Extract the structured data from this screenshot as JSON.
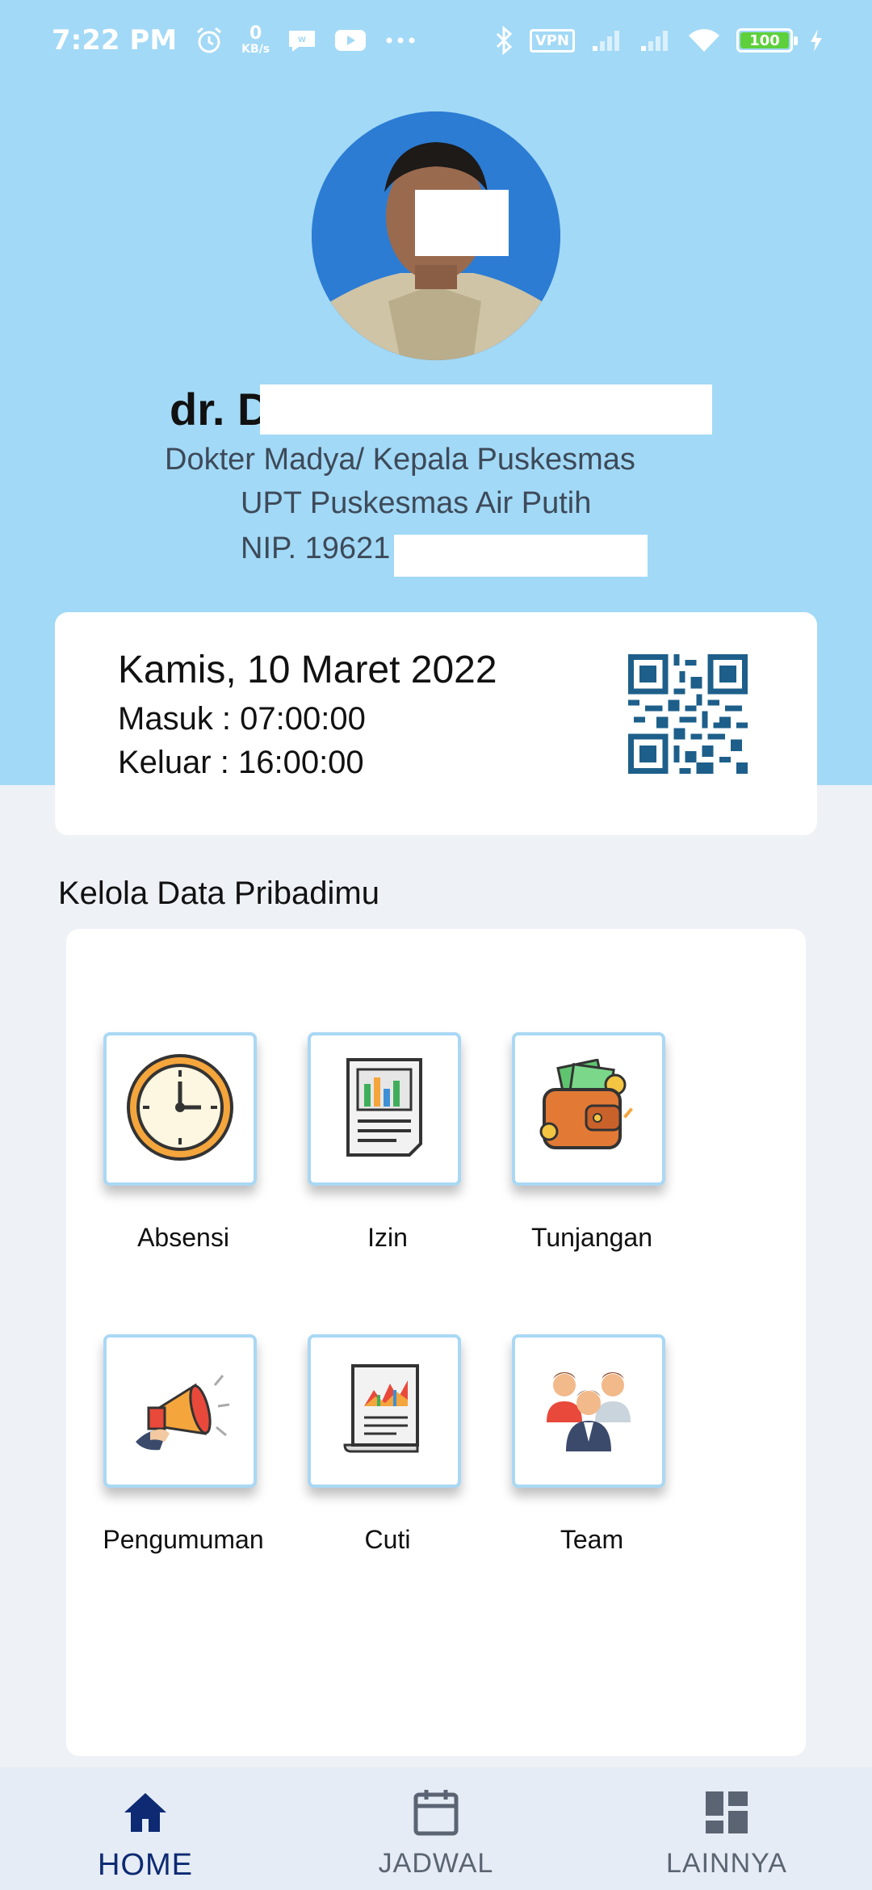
{
  "status_bar": {
    "time": "7:22 PM",
    "speed_value": "0",
    "speed_unit": "KB/s",
    "vpn": "VPN",
    "battery": "100",
    "icons": [
      "alarm-icon",
      "webtoon-icon",
      "youtube-icon",
      "more-icon",
      "bluetooth-icon",
      "signal-icon",
      "wifi-icon",
      "charging-icon"
    ]
  },
  "profile": {
    "name": "dr. D",
    "position": "Dokter  Madya/ Kepala Puskesmas",
    "unit": "UPT Puskesmas Air Putih",
    "nip": "NIP. 19621"
  },
  "attendance": {
    "date": "Kamis, 10 Maret 2022",
    "check_in": "Masuk : 07:00:00",
    "check_out": "Keluar : 16:00:00"
  },
  "section_title": "Kelola Data Pribadimu",
  "menu": [
    {
      "label": "Absensi",
      "icon": "clock-icon"
    },
    {
      "label": "Izin",
      "icon": "document-chart-icon"
    },
    {
      "label": "Tunjangan",
      "icon": "wallet-icon"
    },
    {
      "label": "Pengumuman",
      "icon": "megaphone-icon"
    },
    {
      "label": "Cuti",
      "icon": "report-icon"
    },
    {
      "label": "Team",
      "icon": "team-icon"
    }
  ],
  "bottom_nav": [
    {
      "label": "HOME",
      "icon": "home-icon",
      "active": true
    },
    {
      "label": "JADWAL",
      "icon": "calendar-icon",
      "active": false
    },
    {
      "label": "LAINNYA",
      "icon": "grid-icon",
      "active": false
    }
  ],
  "colors": {
    "hero": "#a2d9f6",
    "background": "#eef1f6",
    "active_nav": "#0d2a73",
    "tile_border": "#a9d8f4"
  }
}
